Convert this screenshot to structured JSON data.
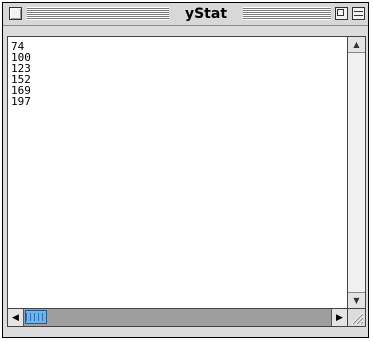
{
  "window": {
    "title": "yStat"
  },
  "content": {
    "lines": [
      "74",
      "100",
      "123",
      "152",
      "169",
      "197"
    ]
  },
  "scrollbar": {
    "up_arrow": "▲",
    "down_arrow": "▼",
    "left_arrow": "◀",
    "right_arrow": "▶",
    "horizontal_position": 0.0
  },
  "icons": {
    "close": "close-box-icon",
    "zoom": "zoom-box-icon",
    "collapse": "collapse-box-icon",
    "grow": "grow-box-icon"
  },
  "colors": {
    "thumb": "#6fb3e8",
    "window_frame": "#dcdcdc"
  }
}
